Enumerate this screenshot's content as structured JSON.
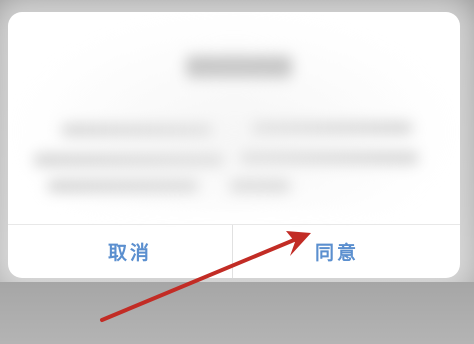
{
  "dialog": {
    "cancel_label": "取消",
    "agree_label": "同意"
  },
  "annotation": {
    "arrow_color": "#c22c25",
    "accent_color": "#5b8fcf"
  }
}
